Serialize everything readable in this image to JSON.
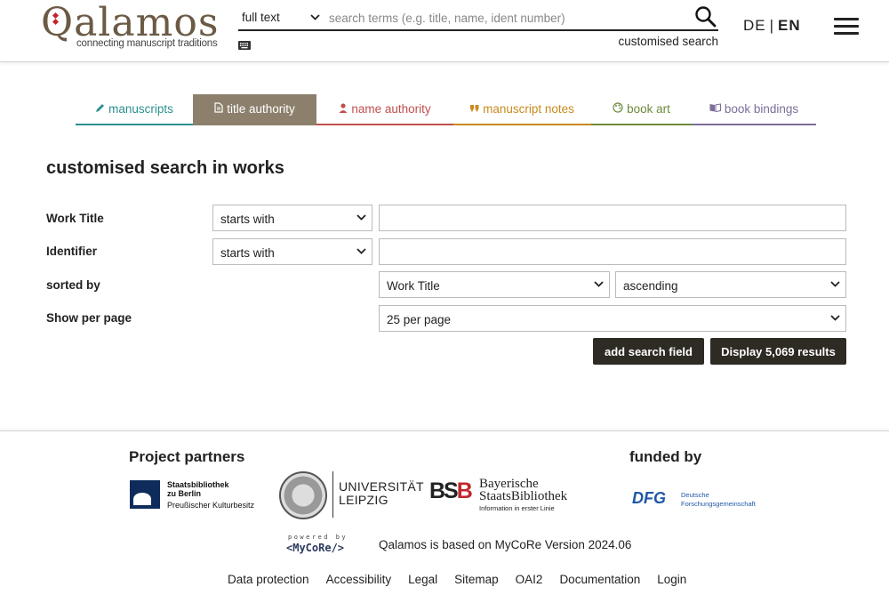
{
  "header": {
    "logo_text": "Qalamos",
    "logo_tagline": "connecting manuscript traditions",
    "search_type": "full text",
    "search_placeholder": "search terms (e.g. title, name, ident number)",
    "customised_search_label": "customised search",
    "lang_de": "DE",
    "lang_sep": "|",
    "lang_en": "EN"
  },
  "tabs": [
    {
      "label": "manuscripts",
      "icon": "pencil-icon",
      "color": "#2c8f8f"
    },
    {
      "label": "title authority",
      "icon": "document-icon",
      "color": "#8c806c",
      "active": true
    },
    {
      "label": "name authority",
      "icon": "person-icon",
      "color": "#c0504d"
    },
    {
      "label": "manuscript notes",
      "icon": "quote-icon",
      "color": "#c98a1e"
    },
    {
      "label": "book art",
      "icon": "palette-icon",
      "color": "#6e8a3c"
    },
    {
      "label": "book bindings",
      "icon": "book-icon",
      "color": "#7d6e9a"
    }
  ],
  "main": {
    "title": "customised search in works",
    "rows": {
      "work_title_label": "Work Title",
      "work_title_operator": "starts with",
      "work_title_value": "",
      "identifier_label": "Identifier",
      "identifier_operator": "starts with",
      "identifier_value": "",
      "sorted_by_label": "sorted by",
      "sorted_by_field": "Work Title",
      "sorted_by_order": "ascending",
      "per_page_label": "Show per page",
      "per_page_value": "25 per page"
    },
    "add_field_button": "add search field",
    "display_button": "Display 5,069 results"
  },
  "footer": {
    "partners_heading": "Project partners",
    "funded_heading": "funded by",
    "sbb_name_1": "Staatsbibliothek",
    "sbb_name_2": "zu Berlin",
    "sbb_sub": "Preußischer Kulturbesitz",
    "leipzig_1": "UNIVERSITÄT",
    "leipzig_2": "LEIPZIG",
    "bsb_mark_a": "BS",
    "bsb_mark_b": "B",
    "bsb_name_1": "Bayerische",
    "bsb_name_2": "StaatsBibliothek",
    "bsb_sub": "Information in erster Linie",
    "dfg_mark": "DFG",
    "dfg_name_1": "Deutsche",
    "dfg_name_2": "Forschungsgemeinschaft",
    "powered_by": "powered by",
    "mycore_logo": "<MyCoRe/>",
    "mycore_text": "Qalamos is based on MyCoRe Version 2024.06",
    "links": [
      "Data protection",
      "Accessibility",
      "Legal",
      "Sitemap",
      "OAI2",
      "Documentation",
      "Login"
    ]
  }
}
